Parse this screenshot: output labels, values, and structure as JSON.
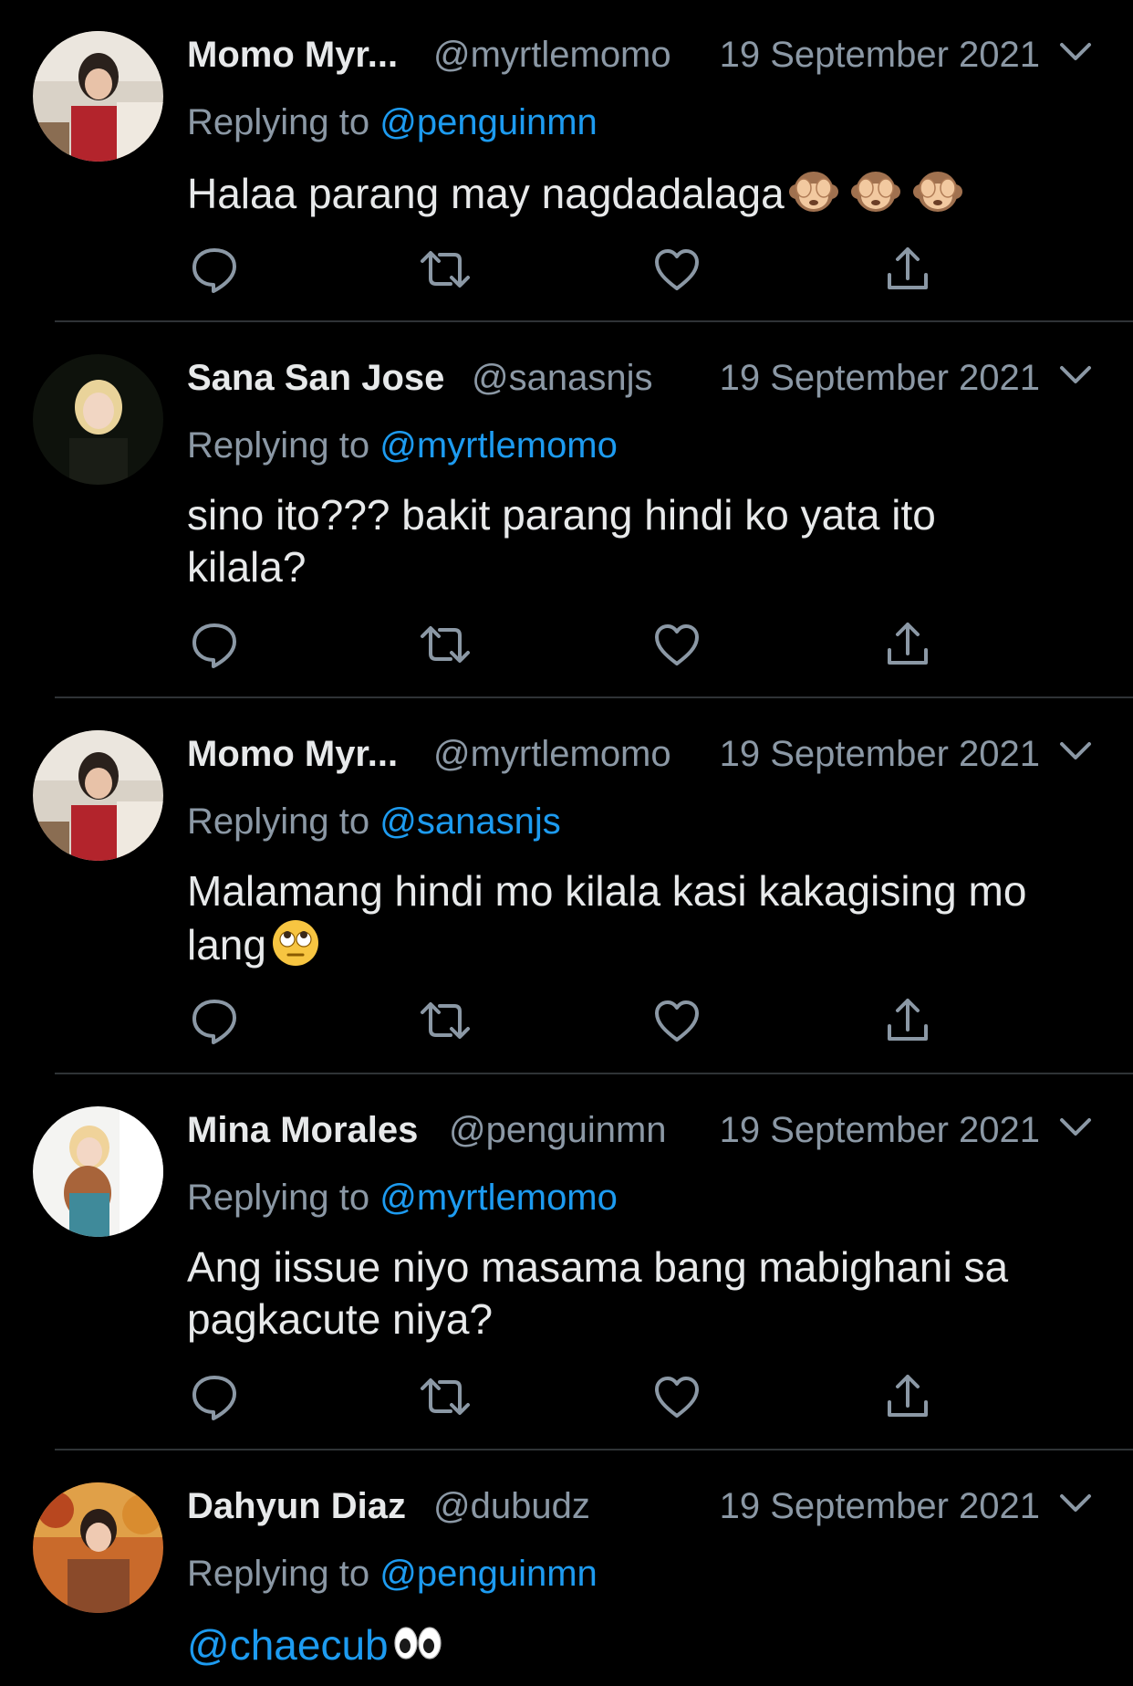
{
  "colors": {
    "background": "#000000",
    "text": "#e7e9ea",
    "muted": "#8b98a5",
    "link": "#1d9bf0",
    "divider": "#2f3336"
  },
  "action_icons": [
    "reply-icon",
    "retweet-icon",
    "like-icon",
    "share-icon"
  ],
  "tweets": [
    {
      "name": "Momo Myr...",
      "handle": "@myrtlemomo",
      "date": "19 September 2021",
      "replying_prefix": "Replying to",
      "replying_to": "@penguinmn",
      "text": "Halaa parang may nagdadalaga",
      "emojis": [
        "see-no-evil-monkey-icon",
        "see-no-evil-monkey-icon",
        "see-no-evil-monkey-icon"
      ]
    },
    {
      "name": "Sana San Jose",
      "handle": "@sanasnjs",
      "date": "19 September 2021",
      "replying_prefix": "Replying to",
      "replying_to": "@myrtlemomo",
      "text": "sino ito??? bakit parang hindi ko yata ito kilala?"
    },
    {
      "name": "Momo Myr...",
      "handle": "@myrtlemomo",
      "date": "19 September 2021",
      "replying_prefix": "Replying to",
      "replying_to": "@sanasnjs",
      "text": "Malamang hindi mo kilala kasi kakagising mo lang",
      "emojis": [
        "eye-roll-face-icon"
      ]
    },
    {
      "name": "Mina Morales",
      "handle": "@penguinmn",
      "date": "19 September 2021",
      "replying_prefix": "Replying to",
      "replying_to": "@myrtlemomo",
      "text": "Ang iissue niyo masama bang mabighani sa pagkacute niya?"
    },
    {
      "name": "Dahyun Diaz",
      "handle": "@dubudz",
      "date": "19 September 2021",
      "replying_prefix": "Replying to",
      "replying_to": "@penguinmn",
      "text_mention": "@chaecub",
      "emojis": [
        "eyes-icon"
      ]
    }
  ]
}
